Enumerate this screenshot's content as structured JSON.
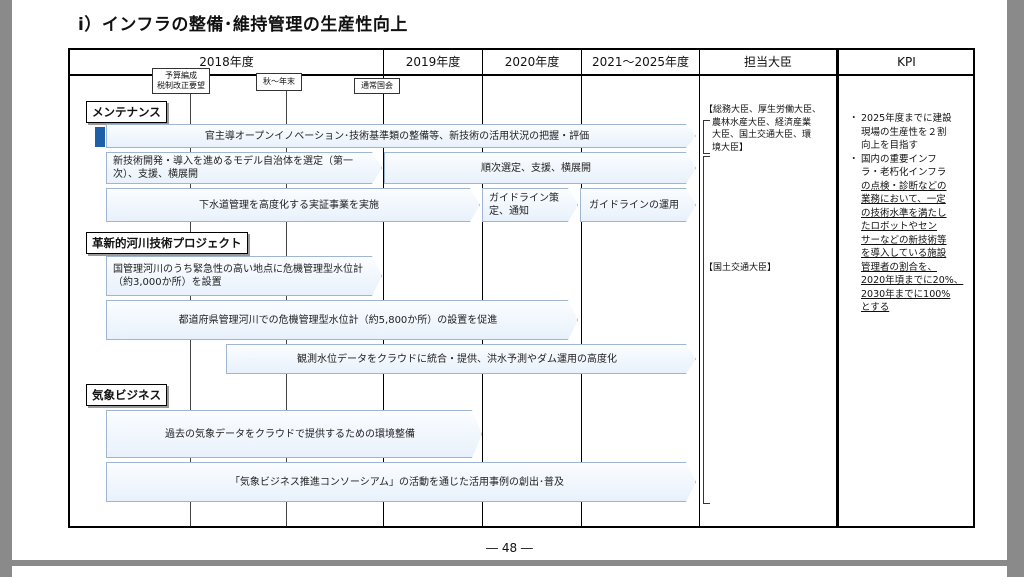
{
  "title": "ⅰ）インフラの整備･維持管理の生産性向上",
  "header": {
    "col_2018": "2018年度",
    "col_2019": "2019年度",
    "col_2020": "2020年度",
    "col_2021": "2021～2025年度",
    "col_minister": "担当大臣",
    "col_kpi": "KPI"
  },
  "tags": {
    "budget_line1": "予算編成",
    "budget_line2": "税制改正要望",
    "autumn": "秋～年末",
    "diet": "通常国会"
  },
  "sections": {
    "maintenance": "メンテナンス",
    "river": "革新的河川技術プロジェクト",
    "weather": "気象ビジネス"
  },
  "arrows": {
    "a1": "官主導オープンイノベーション･技術基準類の整備等、新技術の活用状況の把握・評価",
    "a2_left": "新技術開発・導入を進めるモデル自治体を選定（第一次）、支援、横展開",
    "a2_right": "順次選定、支援、横展開",
    "a3_left": "下水道管理を高度化する実証事業を実施",
    "a3_mid": "ガイドライン策定、通知",
    "a3_right": "ガイドラインの運用",
    "r1": "国管理河川のうち緊急性の高い地点に危機管理型水位計（約3,000か所）を設置",
    "r2": "都道府県管理河川での危機管理型水位計（約5,800か所）の設置を促進",
    "r3": "観測水位データをクラウドに統合・提供、洪水予測やダム運用の高度化",
    "w1": "過去の気象データをクラウドで提供するための環境整備",
    "w2": "「気象ビジネス推進コンソーシアム」の活動を通じた活用事例の創出･普及"
  },
  "ministers": {
    "m1_l1": "【総務大臣、厚生労働大臣、",
    "m1_l2": "農林水産大臣、経済産業",
    "m1_l3": "大臣、国土交通大臣、環",
    "m1_l4": "境大臣】",
    "m2": "【国土交通大臣】"
  },
  "kpi": {
    "k1_l1": "2025年度までに建設",
    "k1_l2": "現場の生産性を２割",
    "k1_l3": "向上を目指す",
    "k2_l1": "国内の重要インフ",
    "k2_l2": "ラ・老朽化インフラ",
    "k2_l3": "の点検・診断などの",
    "k2_l4": "業務において、一定",
    "k2_l5": "の技術水準を満たし",
    "k2_l6": "たロボットやセン",
    "k2_l7": "サーなどの新技術等",
    "k2_l8": "を導入している施設",
    "k2_l9": "管理者の割合を、",
    "k2_l10": "2020年頃までに20%、",
    "k2_l11": "2030年までに100%",
    "k2_l12": "とする"
  },
  "page_number": "― 48 ―"
}
